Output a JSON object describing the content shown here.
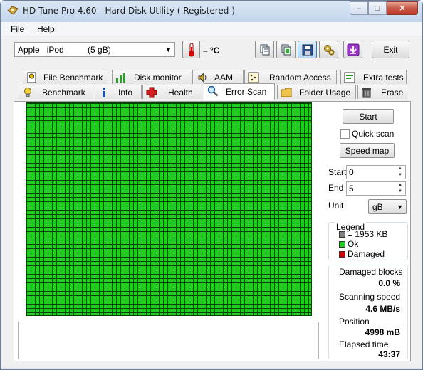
{
  "window": {
    "title": "HD Tune Pro 4.60 - Hard Disk Utility (  Registered )",
    "minimize_glyph": "–",
    "maximize_glyph": "□",
    "close_glyph": "✕"
  },
  "menu": {
    "file": "File",
    "help": "Help"
  },
  "toolbar": {
    "drive": "Apple   iPod          (5 gB)",
    "temperature": "– °C",
    "exit_label": "Exit",
    "icons": [
      "thermometer-icon",
      "copy-text-icon",
      "copy-screenshot-icon",
      "save-icon",
      "options-icon",
      "download-icon"
    ]
  },
  "tabs": {
    "row1": [
      {
        "label": "File Benchmark",
        "icon": "file-benchmark-icon"
      },
      {
        "label": "Disk monitor",
        "icon": "disk-monitor-icon"
      },
      {
        "label": "AAM",
        "icon": "speaker-icon"
      },
      {
        "label": "Random Access",
        "icon": "random-access-icon"
      },
      {
        "label": "Extra tests",
        "icon": "extra-tests-icon"
      }
    ],
    "row2": [
      {
        "label": "Benchmark",
        "icon": "lightbulb-icon"
      },
      {
        "label": "Info",
        "icon": "info-icon"
      },
      {
        "label": "Health",
        "icon": "health-cross-icon"
      },
      {
        "label": "Error Scan",
        "icon": "magnifier-icon",
        "active": true
      },
      {
        "label": "Folder Usage",
        "icon": "folder-icon"
      },
      {
        "label": "Erase",
        "icon": "trash-icon"
      }
    ]
  },
  "error_scan": {
    "start_button": "Start",
    "quick_scan_label": "Quick scan",
    "quick_scan_checked": false,
    "speed_map_button": "Speed map",
    "start_label": "Start",
    "start_value": "0",
    "end_label": "End",
    "end_value": "5",
    "unit_label": "Unit",
    "unit_value": "gB",
    "legend": {
      "title": "Legend",
      "block_size": "= 1953 KB",
      "ok": "Ok",
      "damaged": "Damaged",
      "colors": {
        "block": "#808080",
        "ok": "#1ad21a",
        "damaged": "#cc0000"
      }
    },
    "stats": {
      "damaged_blocks_label": "Damaged blocks",
      "damaged_blocks_value": "0.0 %",
      "scanning_speed_label": "Scanning speed",
      "scanning_speed_value": "4.6 MB/s",
      "position_label": "Position",
      "position_value": "4998 mB",
      "elapsed_label": "Elapsed time",
      "elapsed_value": "43:37"
    },
    "grid_color": "#1ad21a",
    "grid_line_color": "#064406"
  }
}
